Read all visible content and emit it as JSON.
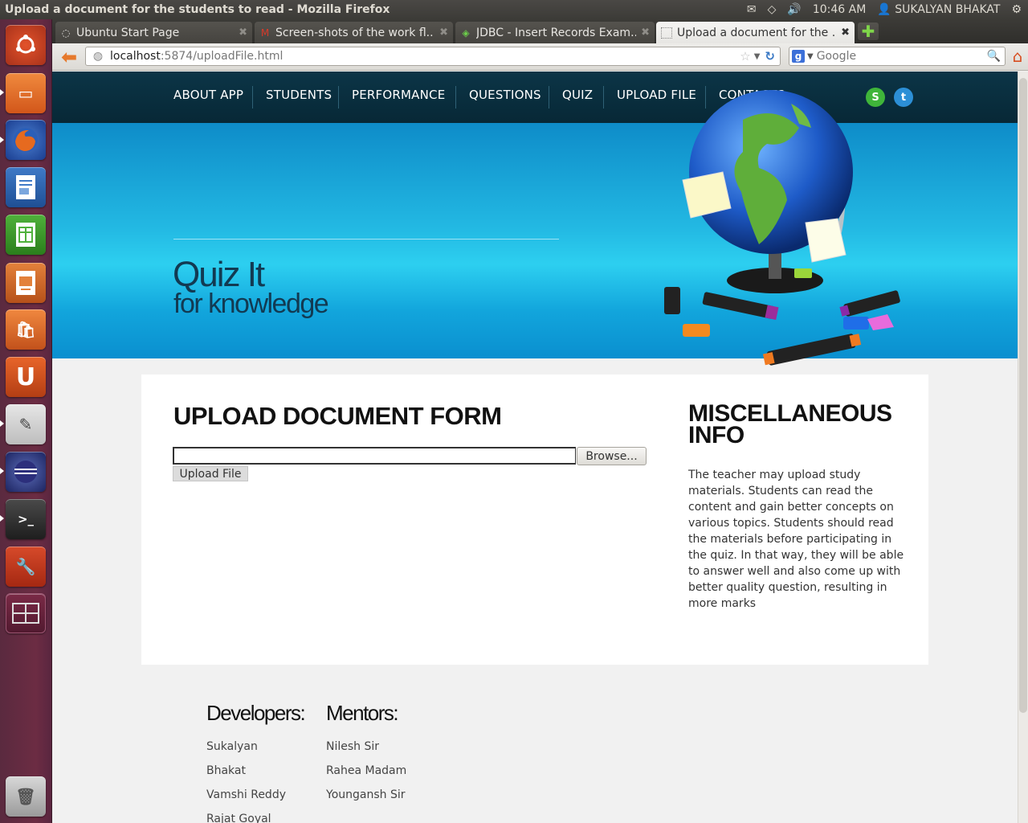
{
  "window": {
    "title": "Upload a document for the students to read - Mozilla Firefox"
  },
  "tray": {
    "time": "10:46 AM",
    "user": "SUKALYAN BHAKAT"
  },
  "tabs": [
    {
      "label": "Ubuntu Start Page",
      "icon": "ubuntu-icon"
    },
    {
      "label": "Screen-shots of the work fl...",
      "icon": "gmail-icon"
    },
    {
      "label": "JDBC - Insert Records Exam...",
      "icon": "diamond-icon"
    },
    {
      "label": "Upload a document for the ...",
      "icon": "blank-page-icon"
    }
  ],
  "urlbar": {
    "host": "localhost",
    "path": ":5874/uploadFile.html"
  },
  "searchbar": {
    "placeholder": "Google"
  },
  "site": {
    "nav": [
      "ABOUT APP",
      "STUDENTS",
      "PERFORMANCE",
      "QUESTIONS",
      "QUIZ",
      "UPLOAD FILE",
      "CONTACTS"
    ],
    "hero_title": "Quiz It",
    "hero_subtitle": "for knowledge",
    "form_title": "UPLOAD DOCUMENT FORM",
    "browse_label": "Browse...",
    "upload_label": "Upload File",
    "misc_title": "MISCELLANEOUS INFO",
    "misc_text": "The teacher may upload study materials. Students can read the content and gain better concepts on various topics. Students should read the materials before participating in the quiz. In that way, they will be able to answer well and also come up with better quality question, resulting in more marks",
    "developers_title": "Developers:",
    "developers": [
      "Sukalyan",
      "Bhakat",
      "Vamshi Reddy",
      "Rajat Goyal"
    ],
    "mentors_title": "Mentors:",
    "mentors": [
      "Nilesh Sir",
      "Rahea Madam",
      "Youngansh Sir"
    ]
  }
}
